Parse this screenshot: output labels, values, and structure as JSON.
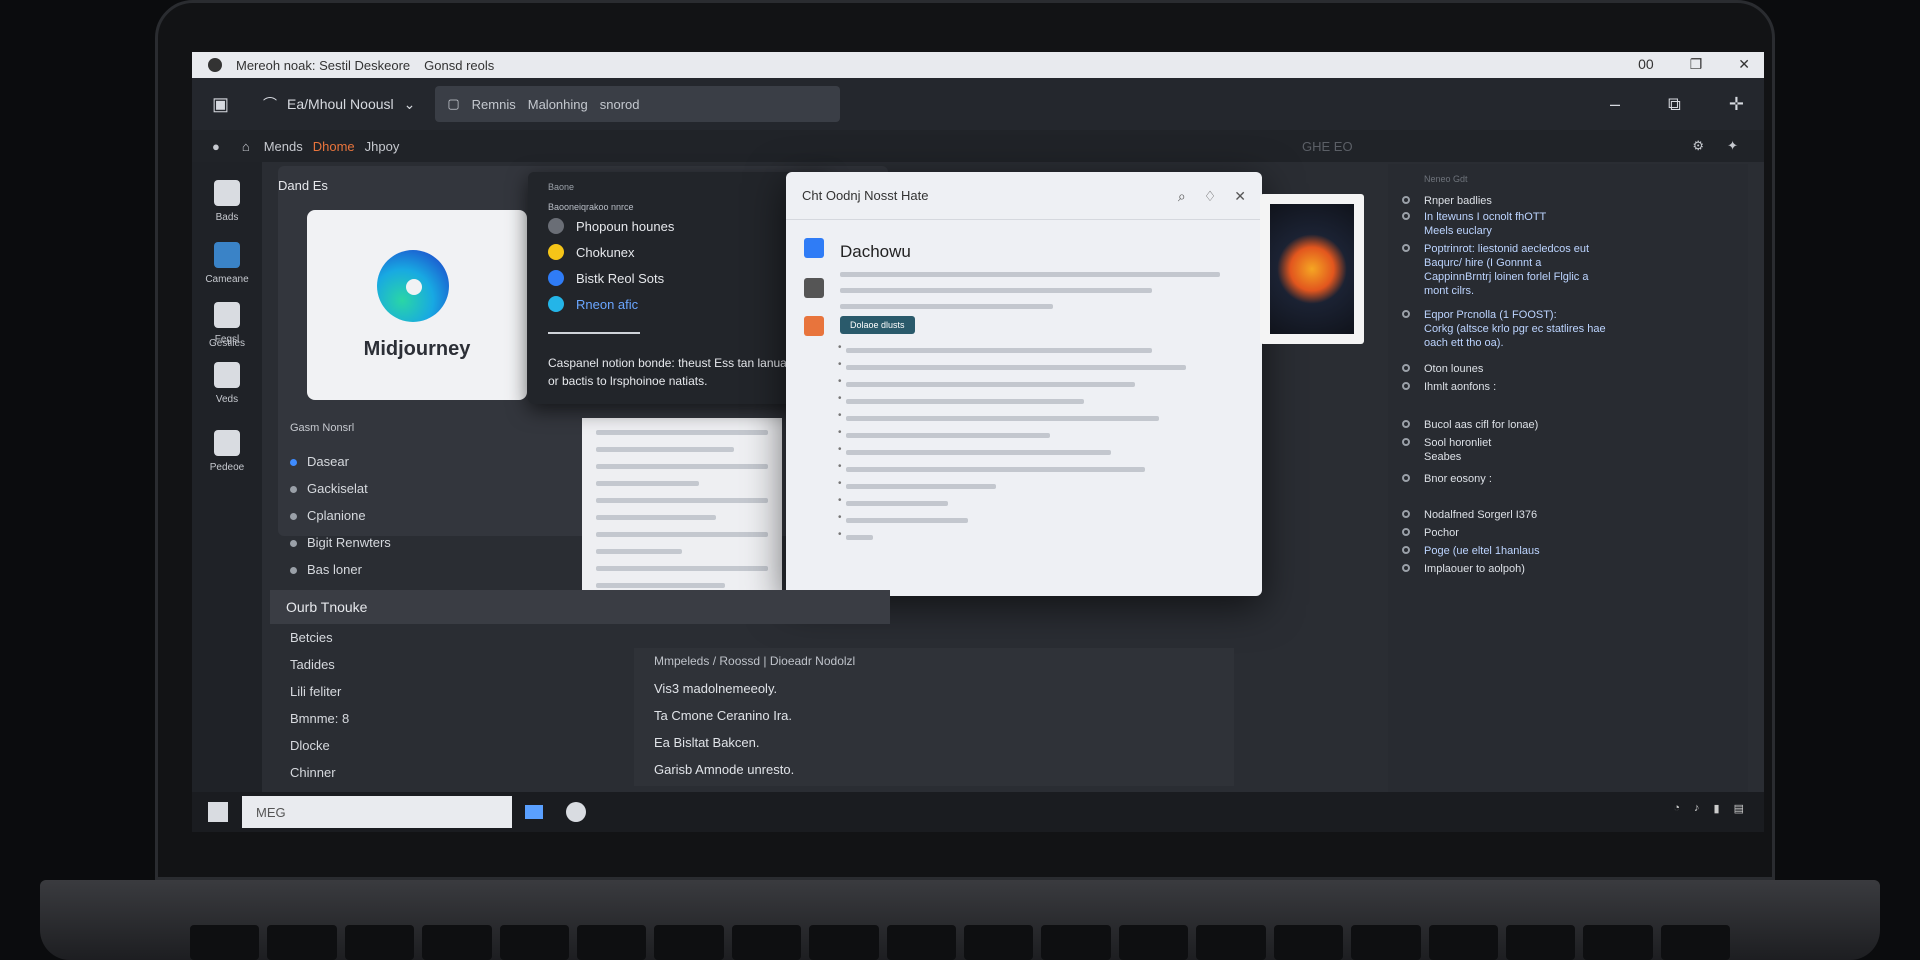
{
  "window": {
    "title": "Mereoh noak: Sestil Deskeore",
    "tab_extra": "Gonsd reols",
    "right_label": "00"
  },
  "toolbar": {
    "active_tab": "Ea/Mhoul Noousl",
    "tab2_label": "Remnis",
    "tab2_sub": "Malonhing",
    "tab2_tail": "snorod"
  },
  "breadcrumb": {
    "item1": "Mends",
    "item2": "Dhome",
    "item3": "Jhpoy",
    "right": "GHE EO"
  },
  "rail": [
    {
      "label": "Bads"
    },
    {
      "label": "Cameane"
    },
    {
      "label": "Fegsl"
    },
    {
      "label": "Gestiles"
    },
    {
      "label": "Veds"
    },
    {
      "label": "Pedeoe"
    }
  ],
  "left_panel": {
    "title": "Dand Es",
    "card_text": "Midjourney",
    "subheading": "Gasm Nonsrl",
    "items": [
      "Dasear",
      "Gackiselat",
      "Cplanione",
      "Bigit Renwters",
      "Bas loner"
    ]
  },
  "dropdown": {
    "head": "Baone",
    "subhead": "Baooneiqrakoo nnrce",
    "items": [
      "Phopoun hounes",
      "Chokunex",
      "Bistk Reol Sots",
      "Rneon afic"
    ],
    "description": "Caspanel notion bonde: theust Ess tan lanuards or bactis to lrsphoinoe natiats."
  },
  "modal": {
    "header": "Cht Oodnj Nosst Hate",
    "title": "Dachowu",
    "button": "Dolaoe dlusts"
  },
  "section": {
    "header": "Ourb Tnouke"
  },
  "lower_left": [
    "Betcies",
    "Tadides",
    "Lili feliter",
    "Bmnme: 8",
    "Dlocke",
    "Chinner"
  ],
  "center_list": {
    "header": "Mmpeleds / Roossd | Dioeadr Nodolzl",
    "items": [
      "Vis3 madolnemeeoly.",
      "Ta Cmone Ceranino Ira.",
      "Ea Bisltat Bakcen.",
      "Garisb Amnode unresto."
    ]
  },
  "right_panel": {
    "title": "Neneo Gdt",
    "items": [
      "Rnper badlies",
      "In ltewuns I ocnolt fhOTT\nMeels euclary",
      "Poptrinrot: liestonid aecledcos eut\nBaqurc/ hire (I Gonnnt a\nCappinnBrntrj loinen forlel Flglic a\nmont cilrs.",
      "Eqpor Prcnolla (1 FOOST):\nCorkg (altsce krlo pgr ec statlires hae\noach ett tho oa).",
      "Oton lounes",
      "Ihmlt aonfons :",
      "Bucol aas cifl for lonae)",
      "Sool horonliet\nSeabes",
      "Bnor eosony :",
      "Nodalfned Sorgerl I376",
      "Pochor",
      "Poge (ue eltel 1hanlaus",
      "Implaouer to aolpoh)"
    ]
  },
  "taskbar": {
    "search": "MEG"
  }
}
